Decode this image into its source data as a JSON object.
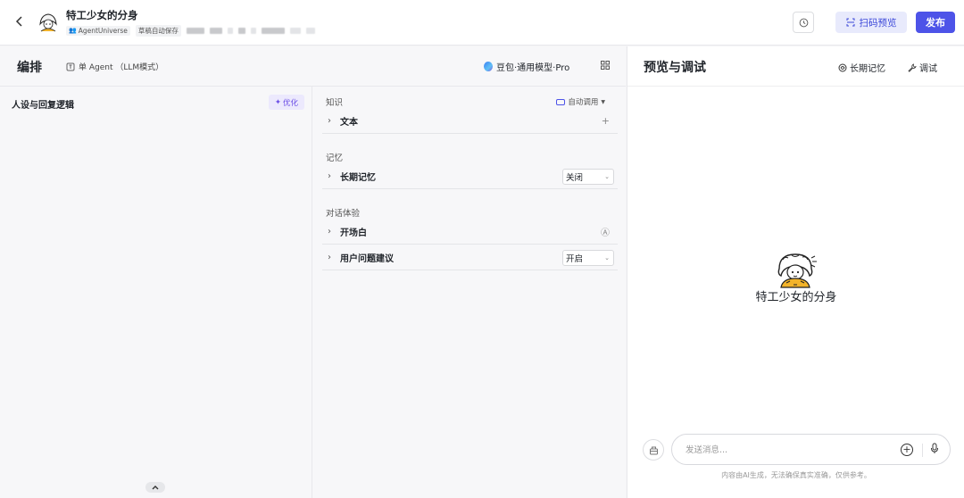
{
  "header": {
    "title": "特工少女的分身",
    "team_chip": "AgentUniverse",
    "save_status": "草稿自动保存",
    "scan_preview_label": "扫码预览",
    "publish_label": "发布"
  },
  "editor": {
    "title": "编排",
    "mode": "单 Agent （LLM模式）",
    "model": "豆包·通用模型·Pro",
    "persona": {
      "title": "人设与回复逻辑",
      "optimize_label": "优化"
    },
    "knowledge": {
      "section_label": "知识",
      "auto_call_label": "自动调用",
      "text_label": "文本"
    },
    "memory": {
      "section_label": "记忆",
      "long_term_label": "长期记忆",
      "long_term_value": "关闭"
    },
    "dialog": {
      "section_label": "对话体验",
      "opening_label": "开场白",
      "suggestions_label": "用户问题建议",
      "suggestions_value": "开启"
    }
  },
  "preview": {
    "title": "预览与调试",
    "long_term_memory_label": "长期记忆",
    "debug_label": "调试",
    "bot_name": "特工少女的分身",
    "input_placeholder": "发送消息...",
    "disclaimer": "内容由AI生成，无法确保真实准确，仅供参考。"
  },
  "colors": {
    "accent": "#4d53e8",
    "accent_light": "#e8eafc",
    "optimize_bg": "#ece9fd",
    "optimize_text": "#6b4ee6"
  },
  "icons": [
    "back-arrow-icon",
    "history-icon",
    "scan-icon",
    "agent-mode-icon",
    "model-logo-icon",
    "grid-icon",
    "sparkle-icon",
    "chevron-right-icon",
    "plus-icon",
    "auto-call-icon",
    "chevron-down-icon",
    "opening-icon",
    "collapse-up-icon",
    "memory-icon",
    "wrench-icon",
    "clear-context-icon",
    "add-circle-icon",
    "microphone-icon"
  ]
}
